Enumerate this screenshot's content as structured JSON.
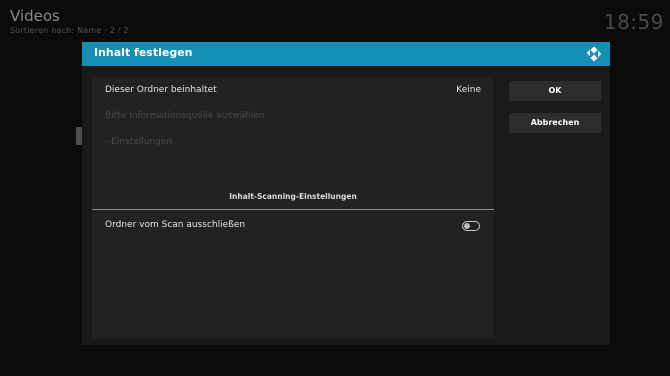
{
  "app": {
    "title": "Videos",
    "sort_info": "Sortieren nach: Name  ·  2 / 2",
    "clock": "18:59"
  },
  "dialog": {
    "title": "Inhalt festlegen",
    "logo_icon": "kodi-logo-icon",
    "rows": [
      {
        "label": "Dieser Ordner beinhaltet",
        "value": "Keine"
      },
      {
        "label": "Bitte Informationsquelle auswählen"
      },
      {
        "label": "- Einstellungen"
      }
    ],
    "section_title": "Inhalt-Scanning-Einstellungen",
    "exclude_toggle": {
      "label": "Ordner vom Scan ausschließen",
      "on": false
    },
    "buttons": {
      "ok": "OK",
      "cancel": "Abbrechen"
    }
  },
  "colors": {
    "accent": "#168fb4",
    "background": "#0b0b0b",
    "dialog": "#1a1a1a",
    "panel": "#222222"
  }
}
